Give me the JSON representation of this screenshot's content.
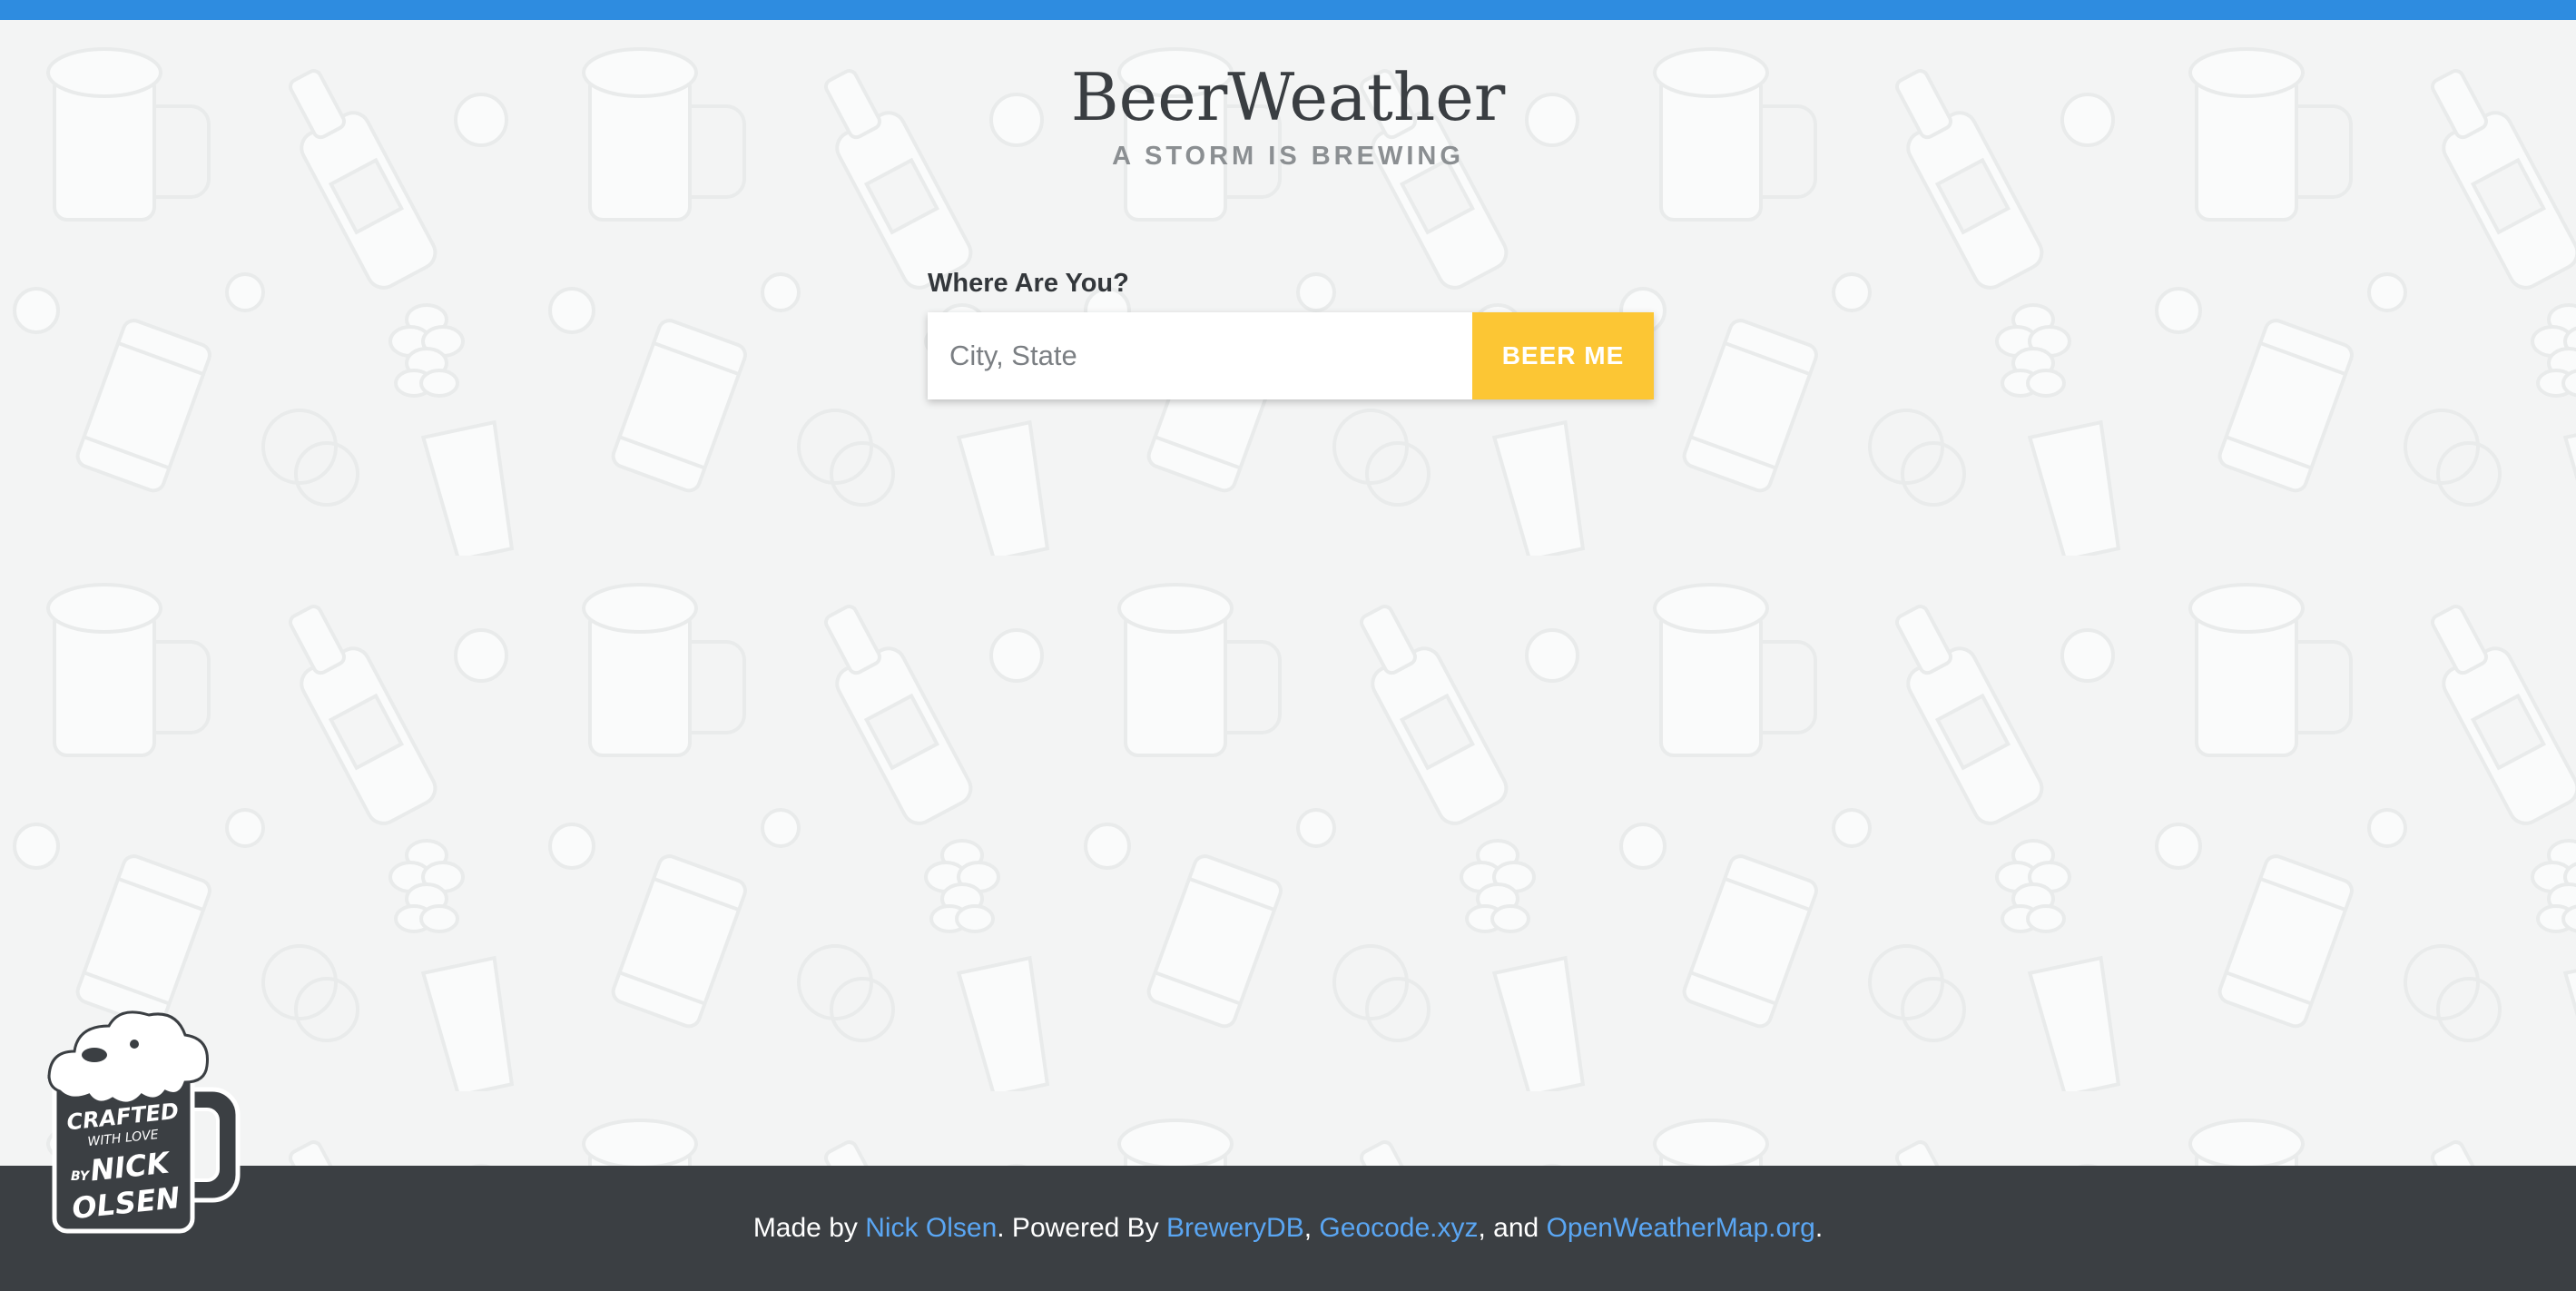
{
  "colors": {
    "top_bar": "#2e8ce0",
    "button_bg": "#fcc634",
    "footer_bg": "#3b3f43",
    "link": "#5aa6f3"
  },
  "header": {
    "title": "BeerWeather",
    "subtitle": "A STORM IS BREWING"
  },
  "search": {
    "label": "Where Are You?",
    "placeholder": "City, State",
    "value": "",
    "button_label": "BEER ME"
  },
  "footer": {
    "text_made_by": "Made by ",
    "author_link": "Nick Olsen",
    "text_powered": ". Powered By ",
    "link_brewerydb": "BreweryDB",
    "sep_1": ", ",
    "link_geocode": "Geocode.xyz",
    "sep_2": ", and ",
    "link_owm": "OpenWeatherMap.org",
    "end": "."
  },
  "badge": {
    "icon": "beer-mug-icon",
    "line1": "CRAFTED",
    "line2": "WITH LOVE",
    "line3": "BY",
    "line4": "NICK",
    "line5": "OLSEN"
  }
}
